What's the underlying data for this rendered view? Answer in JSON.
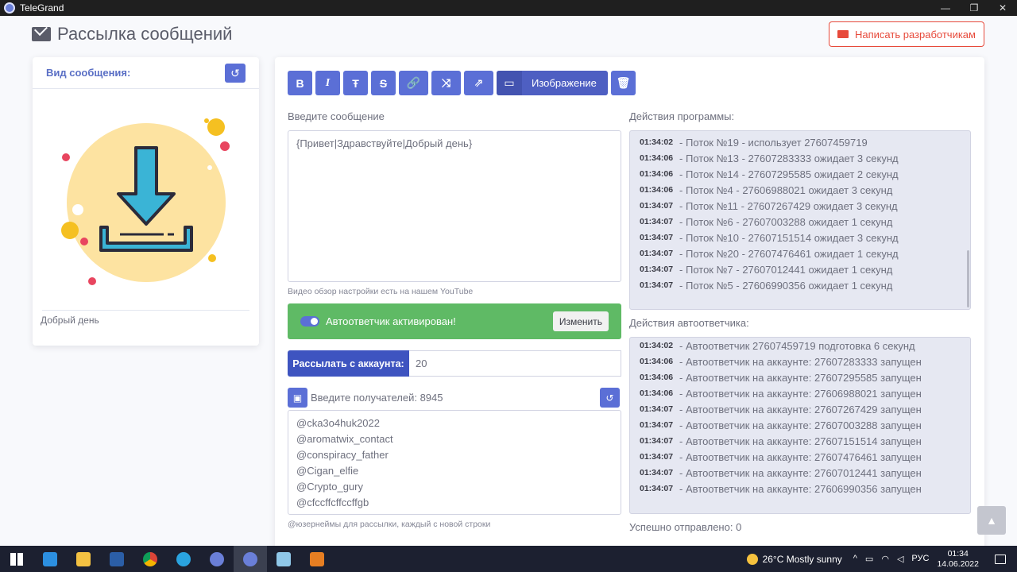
{
  "window": {
    "title": "TeleGrand"
  },
  "header": {
    "title": "Рассылка сообщений",
    "dev_button": "Написать разработчикам"
  },
  "preview_card": {
    "title": "Вид сообщения:",
    "preview_text": "Добрый день"
  },
  "toolbar": {
    "image_label": "Изображение",
    "bold": "B",
    "italic": "I"
  },
  "editor": {
    "label": "Введите сообщение",
    "value": "{Привет|Здравствуйте|Добрый день}",
    "hint": "Видео обзор настройки есть на нашем YouTube"
  },
  "autoresponder": {
    "status": "Автоответчик активирован!",
    "change_label": "Изменить",
    "enabled": true
  },
  "accounts": {
    "label": "Рассылать с аккаунта:",
    "value": "20"
  },
  "recipients": {
    "label": "Введите получателей: 8945",
    "items": [
      "@cka3o4huk2022",
      "@aromatwix_contact",
      "@conspiracy_father",
      "@Cigan_elfie",
      "@Crypto_gury",
      "@cfccffcffccffgb"
    ],
    "hint": "@юзернеймы для рассылки, каждый с новой строки"
  },
  "program_log": {
    "label": "Действия программы:",
    "lines": [
      {
        "time": "01:34:02",
        "text": "- Поток №19 - использует 27607459719"
      },
      {
        "time": "01:34:06",
        "text": "- Поток №13 - 27607283333 ожидает 3 секунд"
      },
      {
        "time": "01:34:06",
        "text": "- Поток №14 - 27607295585 ожидает 2 секунд"
      },
      {
        "time": "01:34:06",
        "text": "- Поток №4 - 27606988021 ожидает 3 секунд"
      },
      {
        "time": "01:34:07",
        "text": "- Поток №11 - 27607267429 ожидает 3 секунд"
      },
      {
        "time": "01:34:07",
        "text": "- Поток №6 - 27607003288 ожидает 1 секунд"
      },
      {
        "time": "01:34:07",
        "text": "- Поток №10 - 27607151514 ожидает 3 секунд"
      },
      {
        "time": "01:34:07",
        "text": "- Поток №20 - 27607476461 ожидает 1 секунд"
      },
      {
        "time": "01:34:07",
        "text": "- Поток №7 - 27607012441 ожидает 1 секунд"
      },
      {
        "time": "01:34:07",
        "text": "- Поток №5 - 27606990356 ожидает 1 секунд"
      }
    ]
  },
  "auto_log": {
    "label": "Действия автоответчика:",
    "lines": [
      {
        "time": "01:34:02",
        "text": "- Автоответчик 27607459719 подготовка 6 секунд"
      },
      {
        "time": "01:34:06",
        "text": "- Автоответчик на аккаунте: 27607283333 запущен"
      },
      {
        "time": "01:34:06",
        "text": "- Автоответчик на аккаунте: 27607295585 запущен"
      },
      {
        "time": "01:34:06",
        "text": "- Автоответчик на аккаунте: 27606988021 запущен"
      },
      {
        "time": "01:34:07",
        "text": "- Автоответчик на аккаунте: 27607267429 запущен"
      },
      {
        "time": "01:34:07",
        "text": "- Автоответчик на аккаунте: 27607003288 запущен"
      },
      {
        "time": "01:34:07",
        "text": "- Автоответчик на аккаунте: 27607151514 запущен"
      },
      {
        "time": "01:34:07",
        "text": "- Автоответчик на аккаунте: 27607476461 запущен"
      },
      {
        "time": "01:34:07",
        "text": "- Автоответчик на аккаунте: 27607012441 запущен"
      },
      {
        "time": "01:34:07",
        "text": "- Автоответчик на аккаунте: 27606990356 запущен"
      }
    ]
  },
  "status": {
    "sent": "Успешно отправлено: 0"
  },
  "taskbar": {
    "weather": "26°C  Mostly sunny",
    "lang": "РУС",
    "time": "01:34",
    "date": "14.06.2022",
    "apps": [
      "windows-start",
      "vscode",
      "file-explorer",
      "powershell",
      "chrome",
      "telegram",
      "telegrand-1",
      "telegrand-2",
      "notepad",
      "paint"
    ]
  },
  "colors": {
    "primary": "#5b6fd6",
    "success": "#5fba65",
    "danger": "#e74a3b",
    "log_bg": "#e6e8f2"
  }
}
